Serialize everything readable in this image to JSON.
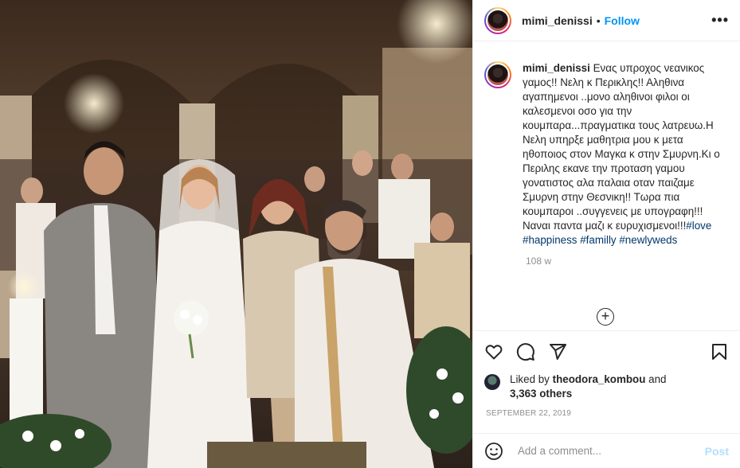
{
  "post": {
    "username": "mimi_denissi",
    "dot": "•",
    "follow_label": "Follow",
    "more_label": "•••"
  },
  "caption": {
    "username": "mimi_denissi",
    "text": "Ενας υπροχος νεανικος γαμος!! Νελη κ Περικλης!! Αληθινα αγαπημενοι ..μονο αληθινοι φιλοι οι καλεσμενοι οσο για την κουμπαρα...πραγματικα τους λατρευω.Η Νελη υπηρξε μαθητρια μου κ μετα ηθοποιος στον Μαγκα κ στην Σμυρνη.Κι ο Περιλης εκανε την προταση γαμου γονατιστος αλα παλαια οταν παιζαμε Σμυρνη στην Θεσνικη!! Τωρα πια κουμπαροι ..συγγενεις με υπογραφη!!! Ναναι παντα μαζι κ ευρυχισμενοι!!!",
    "tags": [
      "#love",
      "#happiness",
      "#familly",
      "#newlyweds"
    ],
    "time": "108 w"
  },
  "icons": {
    "load_more": "plus-circle-icon",
    "like": "heart-icon",
    "comment": "comment-icon",
    "share": "paper-plane-icon",
    "save": "bookmark-icon",
    "emoji": "smiley-icon"
  },
  "likes": {
    "prefix": "Liked by",
    "user": "theodora_kombou",
    "and": "and",
    "count": "3,363 others"
  },
  "date": "SEPTEMBER 22, 2019",
  "comment_box": {
    "placeholder": "Add a comment...",
    "post_label": "Post"
  },
  "colors": {
    "accent": "#0095f6",
    "post_disabled": "#b2dffc",
    "hashtag": "#00376b"
  }
}
